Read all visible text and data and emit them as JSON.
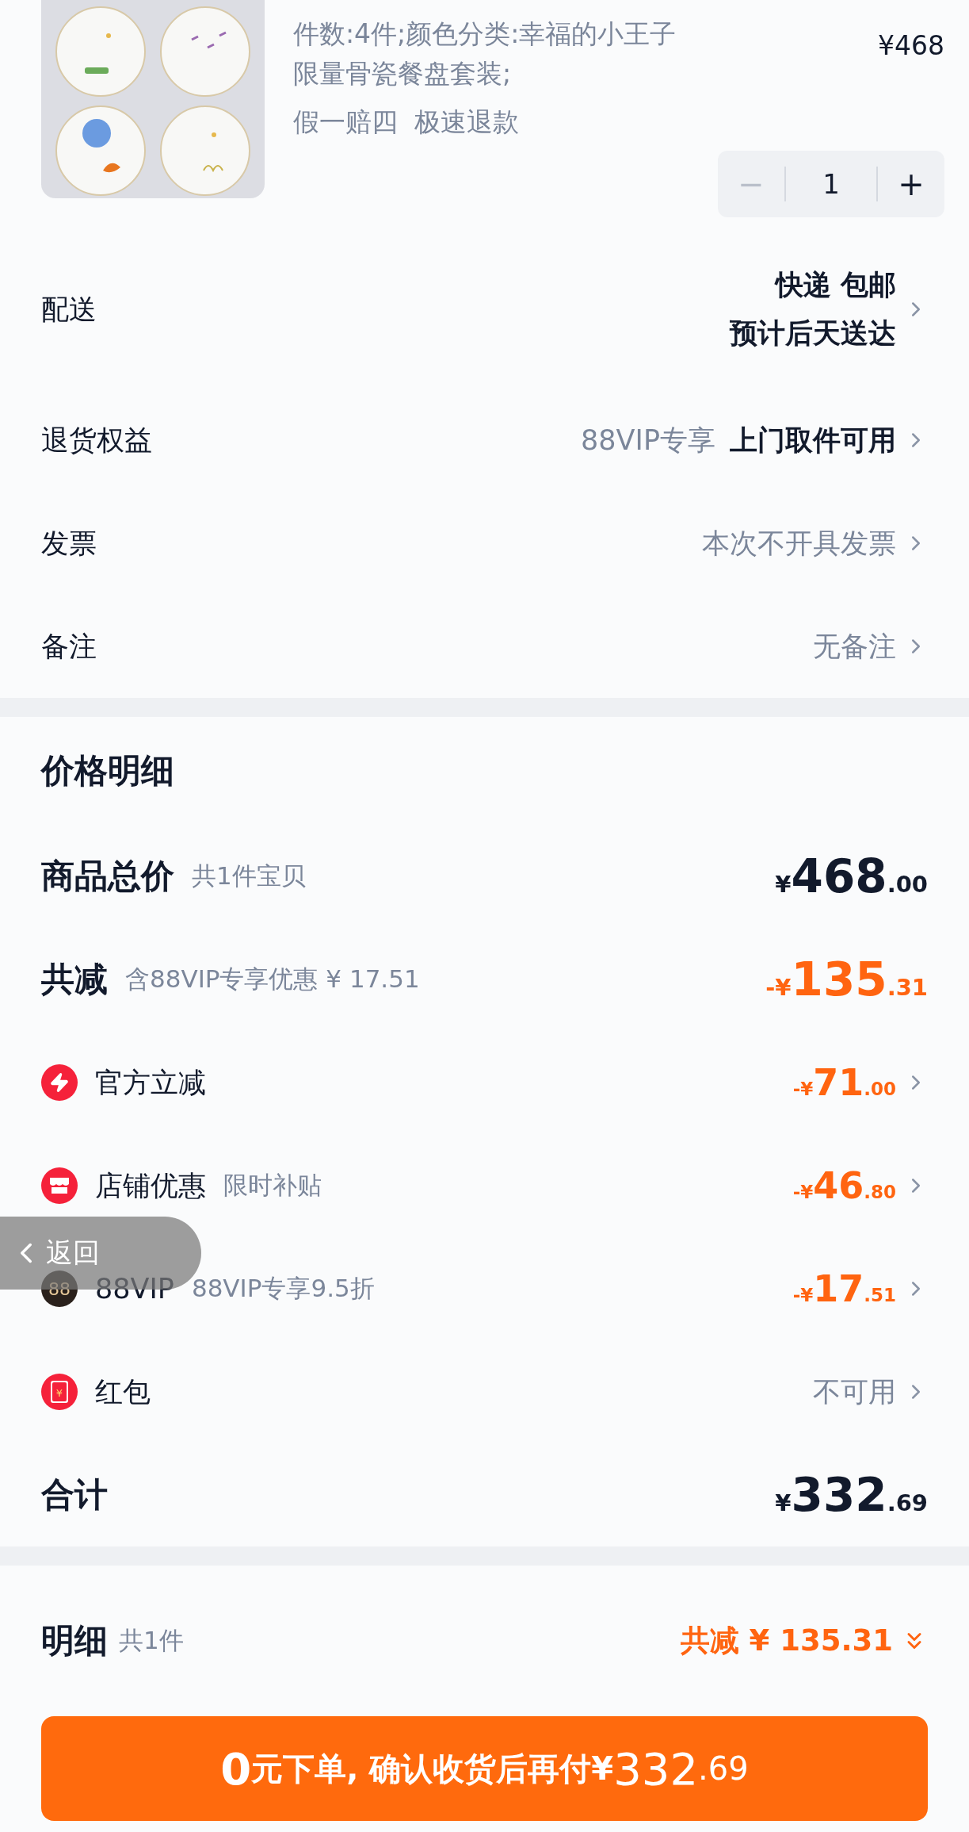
{
  "product": {
    "spec": "件数:4件;颜色分类:幸福的小王子限量骨瓷餐盘套装;",
    "services": "假一赔四  极速退款",
    "price": "¥468",
    "stepper": {
      "minus": "−",
      "quantity": "1",
      "plus": "+",
      "minus_disabled": true
    }
  },
  "order_rows": [
    {
      "label": "配送",
      "values": [
        {
          "text": "快递 包邮",
          "strong": true
        },
        {
          "text": "预计后天送达",
          "strong": true
        }
      ]
    },
    {
      "label": "退货权益",
      "values": [
        {
          "text": "88VIP专享",
          "strong": false
        },
        {
          "text": "上门取件可用",
          "strong": true
        }
      ]
    },
    {
      "label": "发票",
      "values": [
        {
          "text": "本次不开具发票",
          "strong": false
        }
      ]
    },
    {
      "label": "备注",
      "values": [
        {
          "text": "无备注",
          "strong": false
        }
      ]
    }
  ],
  "price_detail": {
    "title": "价格明细",
    "total": {
      "label": "商品总价",
      "note": "共1件宝贝",
      "sign": "¥",
      "integer": "468",
      "decimal": ".00"
    },
    "reduction": {
      "label": "共减",
      "note": "含88VIP专享优惠 ¥ 17.51",
      "sign": "-¥",
      "integer": "135",
      "decimal": ".31"
    },
    "discounts": [
      {
        "label": "官方立减",
        "kind": "amount",
        "sign": "-¥",
        "integer": "71",
        "decimal": ".00"
      },
      {
        "label": "店铺优惠",
        "note": "限时补贴",
        "kind": "amount",
        "sign": "-¥",
        "integer": "46",
        "decimal": ".80"
      },
      {
        "icon_text": "88",
        "label": "88VIP",
        "note": "88VIP专享9.5折",
        "kind": "amount",
        "sign": "-¥",
        "integer": "17",
        "decimal": ".51"
      },
      {
        "icon_text": "¥",
        "label": "红包",
        "kind": "text",
        "value": "不可用"
      }
    ],
    "sum": {
      "label": "合计",
      "sign": "¥",
      "integer": "332",
      "decimal": ".69"
    }
  },
  "footer": {
    "label": "明细",
    "count": "共1件",
    "reduction": "共减 ¥ 135.31",
    "expanded": false,
    "submit": {
      "lead": "0",
      "text": "元下单, 确认收货后再付",
      "sign": "¥",
      "integer": "332",
      "decimal": ".69"
    }
  },
  "back_button": {
    "label": "返回"
  }
}
